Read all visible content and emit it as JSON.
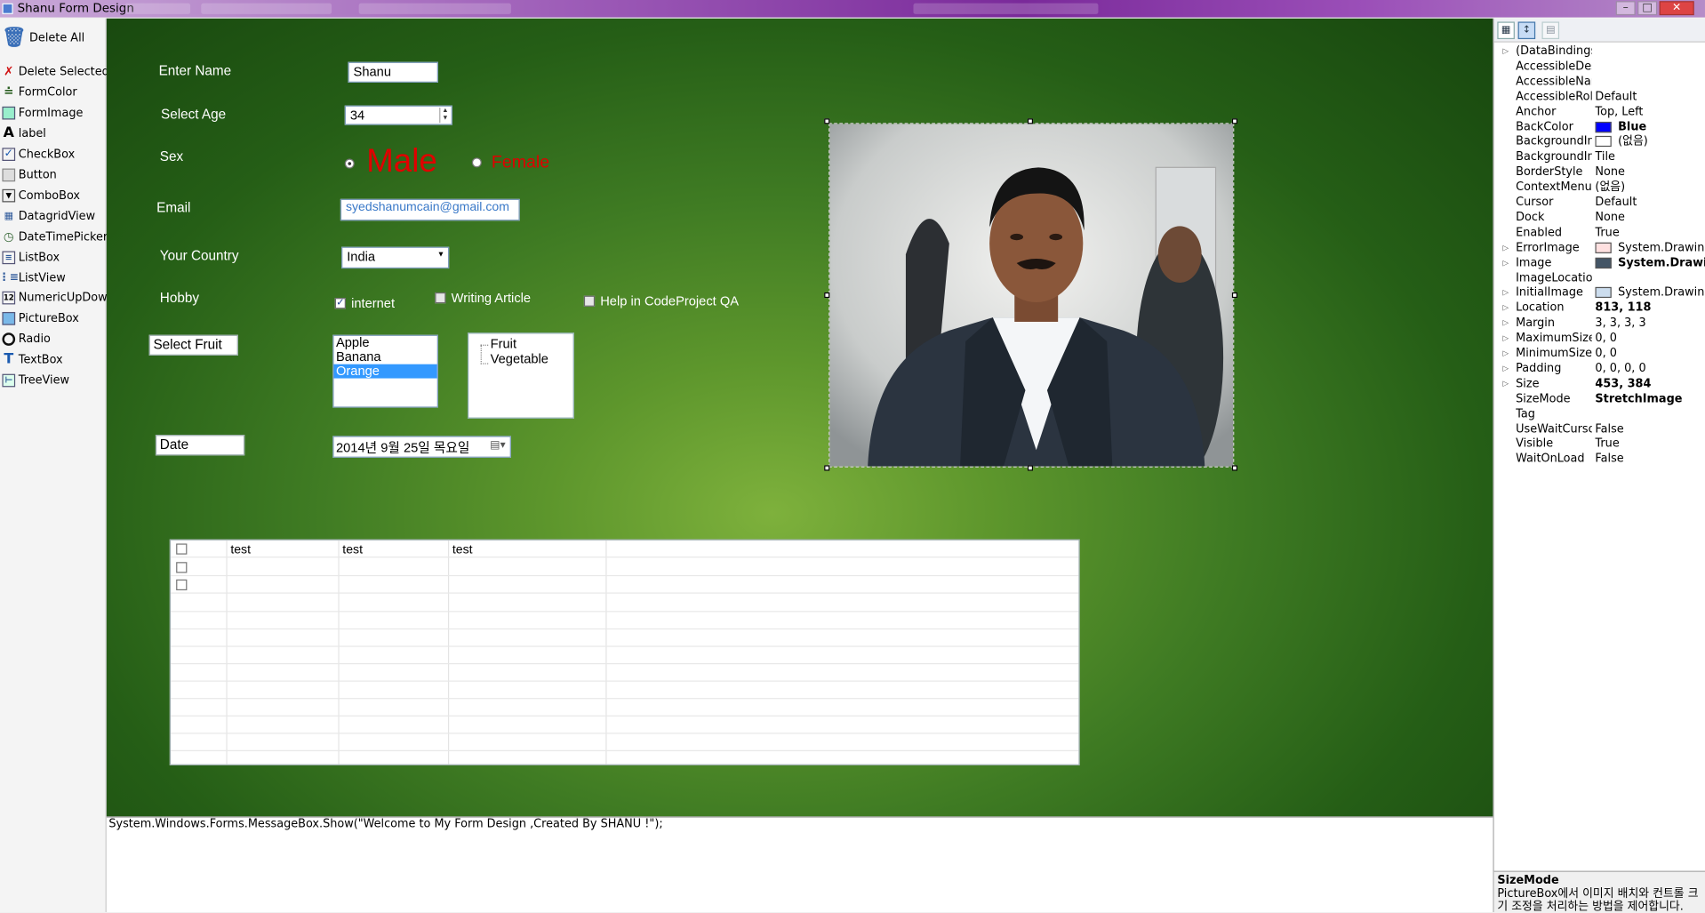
{
  "window": {
    "title": "Shanu Form Design"
  },
  "toolbox": {
    "items": [
      {
        "label": "Delete All",
        "icon": "trash-icon"
      },
      {
        "label": "Delete Selected",
        "icon": "red-x-icon"
      },
      {
        "label": "FormColor",
        "icon": "brush-icon"
      },
      {
        "label": "FormImage",
        "icon": "form-image-icon"
      },
      {
        "label": "label",
        "icon": "label-a-icon"
      },
      {
        "label": "CheckBox",
        "icon": "checkbox-icon"
      },
      {
        "label": "Button",
        "icon": "button-icon"
      },
      {
        "label": "ComboBox",
        "icon": "combobox-icon"
      },
      {
        "label": "DatagridView",
        "icon": "grid-icon"
      },
      {
        "label": "DateTimePicker",
        "icon": "clock-icon"
      },
      {
        "label": "ListBox",
        "icon": "listbox-icon"
      },
      {
        "label": "ListView",
        "icon": "listview-icon"
      },
      {
        "label": "NumericUpDown",
        "icon": "numeric-icon"
      },
      {
        "label": "PictureBox",
        "icon": "picture-icon"
      },
      {
        "label": "Radio",
        "icon": "radio-icon"
      },
      {
        "label": "TextBox",
        "icon": "textbox-icon"
      },
      {
        "label": "TreeView",
        "icon": "treeview-icon"
      }
    ]
  },
  "form": {
    "name_label": "Enter Name",
    "name_value": "Shanu",
    "age_label": "Select Age",
    "age_value": "34",
    "sex_label": "Sex",
    "sex_male": "Male",
    "sex_female": "Female",
    "email_label": "Email",
    "email_value": "syedshanumcain@gmail.com",
    "country_label": "Your Country",
    "country_value": "India",
    "hobby_label": "Hobby",
    "hobby_internet": "internet",
    "hobby_writing": "Writing Article",
    "hobby_help": "Help in CodeProject QA",
    "fruit_label": "Select Fruit",
    "fruit_list": [
      "Apple",
      "Banana",
      "Orange"
    ],
    "fruit_selected": "Orange",
    "tree_nodes": [
      "Fruit",
      "Vegetable"
    ],
    "date_label": "Date",
    "date_value": "2014년   9월 25일 목요일",
    "grid_headers": [
      "test",
      "test",
      "test"
    ],
    "accent_color": "#e00000"
  },
  "code": {
    "text": "System.Windows.Forms.MessageBox.Show(\"Welcome to My Form Design ,Created By SHANU !\");"
  },
  "properties": {
    "rows": [
      {
        "name": "(DataBindings)",
        "value": "",
        "expand": true
      },
      {
        "name": "AccessibleDes",
        "value": ""
      },
      {
        "name": "AccessibleNar",
        "value": ""
      },
      {
        "name": "AccessibleRol",
        "value": "Default"
      },
      {
        "name": "Anchor",
        "value": "Top, Left"
      },
      {
        "name": "BackColor",
        "value": "Blue",
        "bold": true,
        "swatch": "#0000ff"
      },
      {
        "name": "BackgroundIma",
        "value": "(없음)",
        "swatch": "#ffffff"
      },
      {
        "name": "BackgroundIma",
        "value": "Tile"
      },
      {
        "name": "BorderStyle",
        "value": "None"
      },
      {
        "name": "ContextMenuS",
        "value": "(없음)"
      },
      {
        "name": "Cursor",
        "value": "Default"
      },
      {
        "name": "Dock",
        "value": "None"
      },
      {
        "name": "Enabled",
        "value": "True"
      },
      {
        "name": "ErrorImage",
        "value": "System.Drawing.I",
        "expand": true,
        "swatch": "#ffe0e0"
      },
      {
        "name": "Image",
        "value": "System.Drawin",
        "expand": true,
        "bold": true,
        "swatch": "#445566"
      },
      {
        "name": "ImageLocation",
        "value": ""
      },
      {
        "name": "InitialImage",
        "value": "System.Drawing.I",
        "expand": true,
        "swatch": "#ccddee"
      },
      {
        "name": "Location",
        "value": "813, 118",
        "expand": true,
        "bold": true
      },
      {
        "name": "Margin",
        "value": "3, 3, 3, 3",
        "expand": true
      },
      {
        "name": "MaximumSize",
        "value": "0, 0",
        "expand": true
      },
      {
        "name": "MinimumSize",
        "value": "0, 0",
        "expand": true
      },
      {
        "name": "Padding",
        "value": "0, 0, 0, 0",
        "expand": true
      },
      {
        "name": "Size",
        "value": "453, 384",
        "expand": true,
        "bold": true
      },
      {
        "name": "SizeMode",
        "value": "StretchImage",
        "bold": true
      },
      {
        "name": "Tag",
        "value": ""
      },
      {
        "name": "UseWaitCursor",
        "value": "False"
      },
      {
        "name": "Visible",
        "value": "True"
      },
      {
        "name": "WaitOnLoad",
        "value": "False"
      }
    ],
    "desc_title": "SizeMode",
    "desc_text": "PictureBox에서 이미지 배치와 컨트롤 크기 조정을 처리하는 방법을 제어합니다."
  }
}
